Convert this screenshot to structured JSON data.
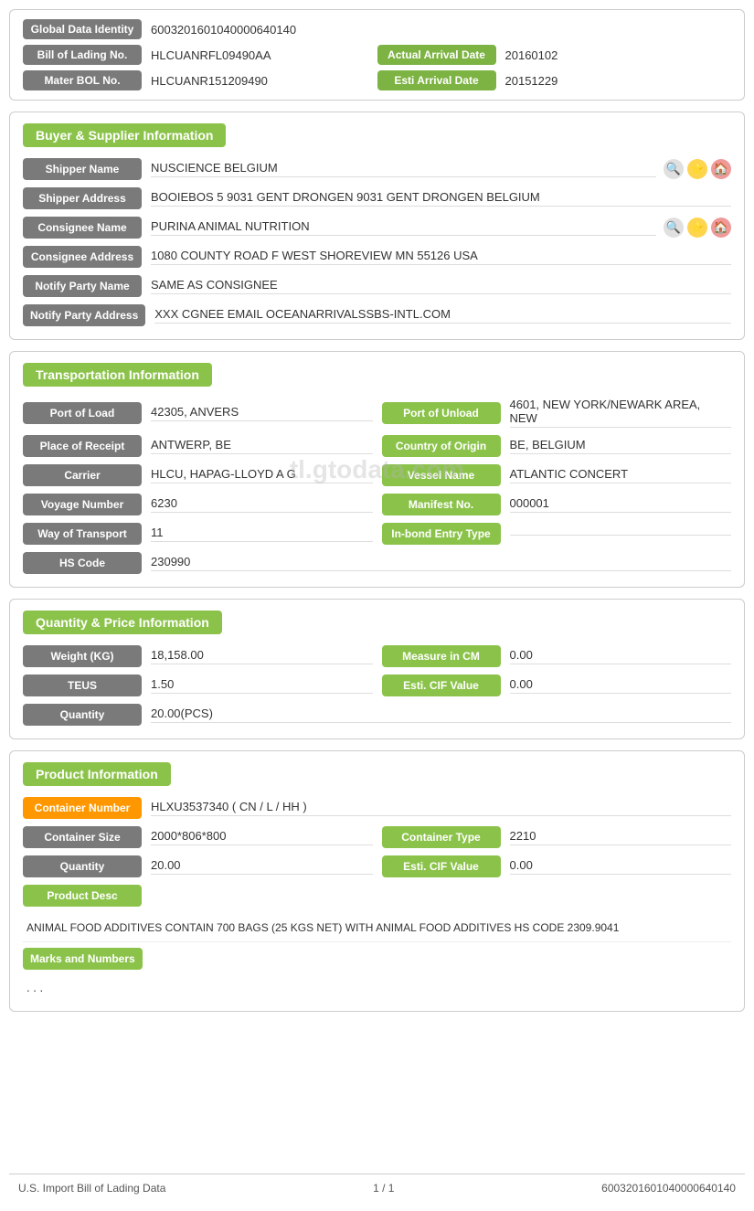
{
  "identity": {
    "global_label": "Global Data Identity",
    "global_value": "60032016010400006401​40",
    "bol_label": "Bill of Lading No.",
    "bol_value": "HLCUANRFL09490AA",
    "actual_arrival_label": "Actual Arrival Date",
    "actual_arrival_value": "20160102",
    "mater_bol_label": "Mater BOL No.",
    "mater_bol_value": "HLCUANR151209490",
    "esti_arrival_label": "Esti Arrival Date",
    "esti_arrival_value": "20151229"
  },
  "buyer_supplier": {
    "section_title": "Buyer & Supplier Information",
    "shipper_name_label": "Shipper Name",
    "shipper_name_value": "NUSCIENCE BELGIUM",
    "shipper_address_label": "Shipper Address",
    "shipper_address_value": "BOOIEBOS 5 9031 GENT DRONGEN 9031 GENT DRONGEN BELGIUM",
    "consignee_name_label": "Consignee Name",
    "consignee_name_value": "PURINA ANIMAL NUTRITION",
    "consignee_address_label": "Consignee Address",
    "consignee_address_value": "1080 COUNTY ROAD F WEST SHOREVIEW MN 55126 USA",
    "notify_party_name_label": "Notify Party Name",
    "notify_party_name_value": "SAME AS CONSIGNEE",
    "notify_party_address_label": "Notify Party Address",
    "notify_party_address_value": "XXX CGNEE EMAIL OCEANARRIVALSSBS-INTL.COM"
  },
  "transportation": {
    "section_title": "Transportation Information",
    "port_of_load_label": "Port of Load",
    "port_of_load_value": "42305, ANVERS",
    "port_of_unload_label": "Port of Unload",
    "port_of_unload_value": "4601, NEW YORK/NEWARK AREA, NEW",
    "place_of_receipt_label": "Place of Receipt",
    "place_of_receipt_value": "ANTWERP, BE",
    "country_of_origin_label": "Country of Origin",
    "country_of_origin_value": "BE, BELGIUM",
    "carrier_label": "Carrier",
    "carrier_value": "HLCU, HAPAG-LLOYD A G",
    "vessel_name_label": "Vessel Name",
    "vessel_name_value": "ATLANTIC CONCERT",
    "voyage_number_label": "Voyage Number",
    "voyage_number_value": "6230",
    "manifest_no_label": "Manifest No.",
    "manifest_no_value": "000001",
    "way_of_transport_label": "Way of Transport",
    "way_of_transport_value": "11",
    "in_bond_entry_label": "In-bond Entry Type",
    "in_bond_entry_value": "",
    "hs_code_label": "HS Code",
    "hs_code_value": "230990"
  },
  "quantity_price": {
    "section_title": "Quantity & Price Information",
    "weight_label": "Weight (KG)",
    "weight_value": "18,158.00",
    "measure_label": "Measure in CM",
    "measure_value": "0.00",
    "teus_label": "TEUS",
    "teus_value": "1.50",
    "esti_cif_label": "Esti. CIF Value",
    "esti_cif_value": "0.00",
    "quantity_label": "Quantity",
    "quantity_value": "20.00(PCS)"
  },
  "product_info": {
    "section_title": "Product Information",
    "container_number_label": "Container Number",
    "container_number_value": "HLXU3537340 ( CN / L / HH )",
    "container_size_label": "Container Size",
    "container_size_value": "2000*806*800",
    "container_type_label": "Container Type",
    "container_type_value": "2210",
    "quantity_label": "Quantity",
    "quantity_value": "20.00",
    "esti_cif_label": "Esti. CIF Value",
    "esti_cif_value": "0.00",
    "product_desc_label": "Product Desc",
    "product_desc_value": "ANIMAL FOOD ADDITIVES CONTAIN 700 BAGS (25 KGS NET) WITH ANIMAL FOOD ADDITIVES HS CODE 2309.9041",
    "marks_label": "Marks and Numbers",
    "marks_value": ". . ."
  },
  "footer": {
    "left": "U.S. Import Bill of Lading Data",
    "center": "1 / 1",
    "right": "60032016010400006401​40"
  },
  "watermark": "tl.gtodata.com"
}
